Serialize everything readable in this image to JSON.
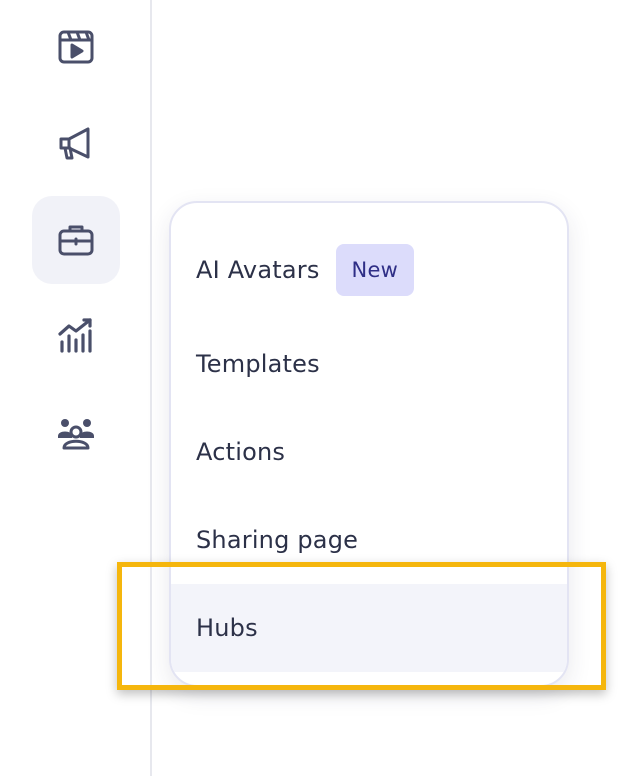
{
  "sidebar": {
    "items": [
      {
        "icon": "video-icon",
        "active": false
      },
      {
        "icon": "megaphone-icon",
        "active": false
      },
      {
        "icon": "briefcase-icon",
        "active": true
      },
      {
        "icon": "analytics-icon",
        "active": false
      },
      {
        "icon": "team-icon",
        "active": false
      }
    ]
  },
  "menu": {
    "items": [
      {
        "label": "AI Avatars",
        "badge": "New"
      },
      {
        "label": "Templates"
      },
      {
        "label": "Actions"
      },
      {
        "label": "Sharing page"
      },
      {
        "label": "Hubs",
        "hovered": true
      }
    ]
  },
  "colors": {
    "icon": "#4a4f6a",
    "active_bg": "#f1f2f8",
    "badge_bg": "#dcdcfb",
    "badge_text": "#2f2e86",
    "highlight": "#f5b60d",
    "menu_hover_bg": "#f3f4fa",
    "text": "#2c3148"
  }
}
